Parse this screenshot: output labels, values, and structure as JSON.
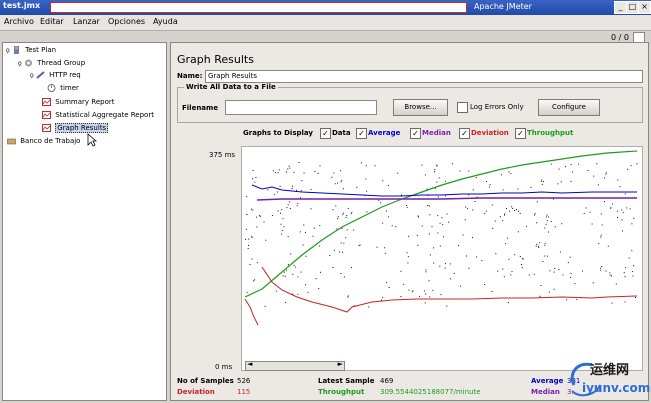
{
  "window": {
    "title": "test.jmx",
    "app": "Apache JMeter"
  },
  "menu": [
    "Archivo",
    "Editar",
    "Lanzar",
    "Opciones",
    "Ayuda"
  ],
  "toolbar": {
    "count": "0 / 0"
  },
  "tree": {
    "test_plan": "Test Plan",
    "thread_group": "Thread Group",
    "http_req": "HTTP req",
    "timer": "timer",
    "summary_report": "Summary Report",
    "stat_agg": "Statistical Aggregate Report",
    "graph_results": "Graph Results",
    "workbench": "Banco de Trabajo"
  },
  "panel": {
    "title": "Graph Results",
    "name_label": "Name:",
    "name_value": "Graph Results",
    "write_all": "Write All Data to a File",
    "filename_label": "Filename",
    "filename_value": "",
    "browse": "Browse...",
    "log_errors": "Log Errors Only",
    "configure": "Configure"
  },
  "graph_options": {
    "label": "Graphs to Display",
    "data": "Data",
    "average": "Average",
    "median": "Median",
    "deviation": "Deviation",
    "throughput": "Throughput",
    "colors": {
      "data": "#000000",
      "average": "#0000cc",
      "median": "#7a1fa8",
      "deviation": "#cc2222",
      "throughput": "#1e9b1e"
    }
  },
  "graph": {
    "ymax": "375 ms",
    "ymin": "0 ms"
  },
  "stats": {
    "samples_label": "No of Samples",
    "samples": "526",
    "latest_label": "Latest Sample",
    "latest": "469",
    "average_label": "Average",
    "average": "381",
    "deviation_label": "Deviation",
    "deviation": "115",
    "throughput_label": "Throughput",
    "throughput": "309.5544025188077/minute",
    "median_label": "Median",
    "median": "3..."
  },
  "watermark": {
    "line1": "运维网",
    "line2": "iyunv.com"
  }
}
